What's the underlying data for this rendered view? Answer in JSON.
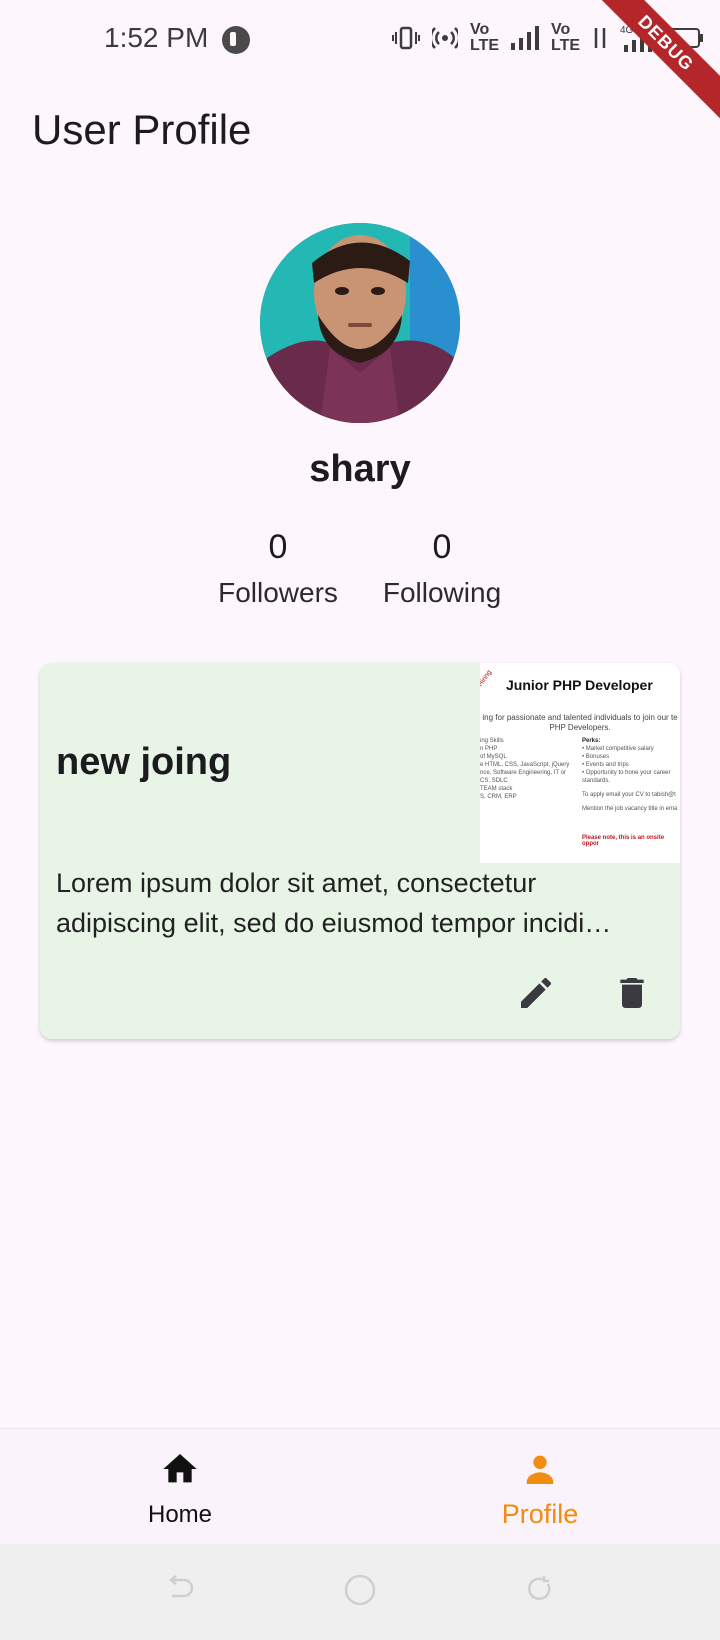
{
  "status_bar": {
    "time": "1:52 PM",
    "icons": [
      "vibrate-icon",
      "hotspot-icon",
      "volte-icon",
      "signal-icon",
      "volte-icon",
      "signal-icon",
      "data-arrows-icon",
      "4g-signal-icon",
      "battery-icon"
    ],
    "volte_label": "Vo\nLTE",
    "network_label": "4G",
    "debug_banner": "DEBUG"
  },
  "header": {
    "title": "User Profile"
  },
  "profile": {
    "name": "shary",
    "followers_count": "0",
    "followers_label": "Followers",
    "following_count": "0",
    "following_label": "Following"
  },
  "posts": [
    {
      "title": "new joing",
      "body_line1": "Lorem ipsum dolor sit amet, consectetur",
      "body_line2": "adipiscing elit, sed do eiusmod tempor incidi…",
      "image": {
        "heading": "Junior PHP Developer",
        "subtitle": "ing for passionate and talented individuals to join our te PHP Developers.",
        "perks_heading": "Perks:",
        "perk_items": [
          "• Market competitive salary",
          "• Bonuses",
          "• Events and trips",
          "• Opportunity to hone your career standards."
        ],
        "left_lines": [
          "ing Skills",
          "n PHP",
          "of MySQL",
          "e HTML, CSS, JavaScript, jQuery",
          "",
          "nce, Software Engineering, IT or",
          "",
          "CS, SDLC",
          "TEAM stack",
          "S, CRM, ERP"
        ],
        "apply_line": "To apply email your CV to tabish@t",
        "mention_line": "Mention the job vacancy title in ema",
        "note_line": "Please note, this is an onsite oppor",
        "stamp": "Hiring"
      }
    }
  ],
  "bottom_nav": {
    "items": [
      {
        "label": "Home",
        "icon": "home-icon",
        "active": false
      },
      {
        "label": "Profile",
        "icon": "person-icon",
        "active": true
      }
    ],
    "active_color": "#f28c0f"
  },
  "system_nav": {
    "buttons": [
      "back-icon",
      "home-circle-icon",
      "recents-icon"
    ]
  }
}
